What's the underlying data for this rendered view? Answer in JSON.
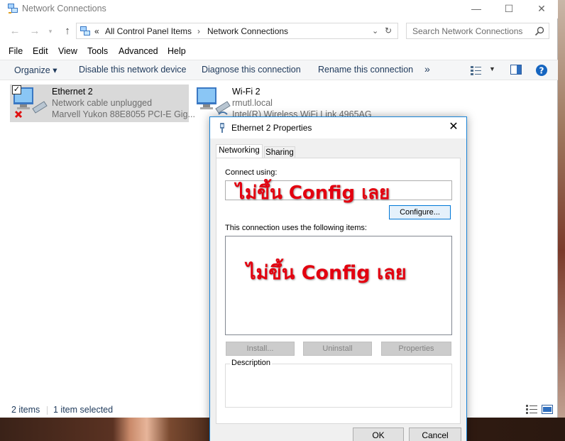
{
  "explorer": {
    "title": "Network Connections",
    "window_controls": {
      "minimize": "—",
      "maximize": "☐",
      "close": "✕"
    },
    "address": {
      "overflow": "«",
      "crumbs": [
        "All Control Panel Items",
        "›",
        "Network Connections"
      ]
    },
    "search_placeholder": "Search Network Connections",
    "menu": [
      "File",
      "Edit",
      "View",
      "Tools",
      "Advanced",
      "Help"
    ],
    "commands": {
      "organize": "Organize ▾",
      "disable": "Disable this network device",
      "diagnose": "Diagnose this connection",
      "rename": "Rename this connection",
      "more": "»"
    },
    "items": [
      {
        "name": "Ethernet 2",
        "status": "Network cable unplugged",
        "device": "Marvell Yukon 88E8055 PCI-E Gig...",
        "selected": true,
        "checked": true
      },
      {
        "name": "Wi-Fi 2",
        "status": "rmutl.local",
        "device": "Intel(R) Wireless WiFi Link 4965AG",
        "selected": false
      }
    ],
    "statusbar": {
      "count": "2 items",
      "selected": "1 item selected"
    }
  },
  "dialog": {
    "title": "Ethernet 2 Properties",
    "tabs": [
      "Networking",
      "Sharing"
    ],
    "connect_using_label": "Connect using:",
    "configure_button": "Configure...",
    "items_label": "This connection uses the following items:",
    "install_button": "Install...",
    "uninstall_button": "Uninstall",
    "properties_button": "Properties",
    "description_label": "Description",
    "ok_button": "OK",
    "cancel_button": "Cancel",
    "overlay_text_1": "ไม่ขึ้น Config เลย",
    "overlay_text_2": "ไม่ขึ้น Config เลย"
  },
  "colors": {
    "accent": "#1883d7",
    "link": "#1e395b",
    "overlay": "#e3000f",
    "selected_bg": "#d9d9d9"
  }
}
